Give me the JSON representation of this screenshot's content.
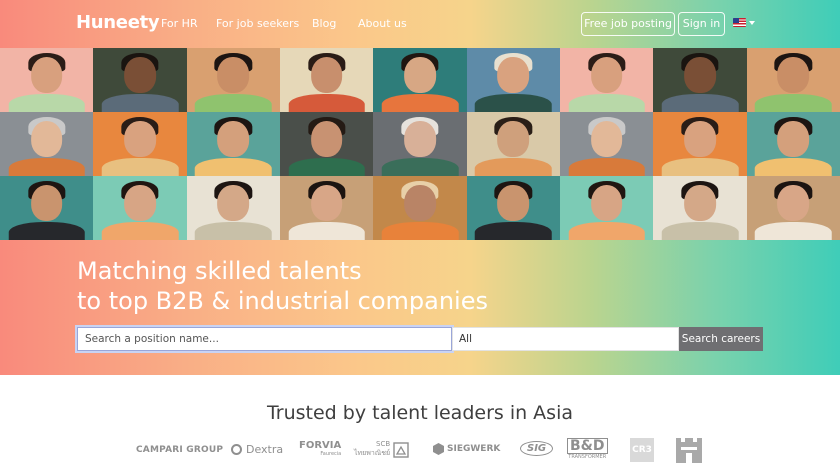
{
  "nav": {
    "logo": "Huneety",
    "links": [
      "For HR",
      "For job seekers",
      "Blog",
      "About us"
    ],
    "free_job_posting": "Free job posting",
    "sign_in": "Sign in",
    "language_icon": "us-flag-icon"
  },
  "hero": {
    "headline_line1": "Matching skilled talents",
    "headline_line2": "to top B2B & industrial companies",
    "search_placeholder": "Search a position name...",
    "location_value": "All",
    "search_button": "Search careers"
  },
  "trusted": {
    "title": "Trusted by talent leaders in Asia",
    "logos": [
      {
        "name": "CAMPARI GROUP"
      },
      {
        "name": "Dextra"
      },
      {
        "name": "FORVIA",
        "sub": "Faurecia"
      },
      {
        "name": "SCB",
        "sub": "ไทยพาณิชย์"
      },
      {
        "name": "SIEGWERK"
      },
      {
        "name": "SIG"
      },
      {
        "name": "B&D",
        "sub": "TRANSFORMER"
      },
      {
        "name": "CR3"
      },
      {
        "name": "castle-logo"
      }
    ]
  },
  "colors": {
    "gradient": [
      "#f98a7c",
      "#fbc78a",
      "#3fcdb8"
    ],
    "search_button": "#6f6f72"
  }
}
